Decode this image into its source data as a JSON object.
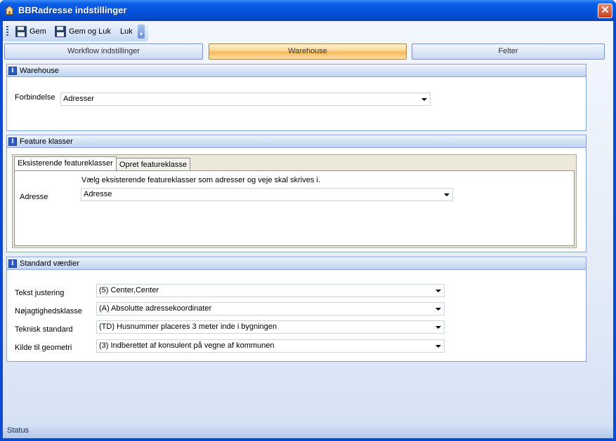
{
  "window": {
    "title": "BBRadresse indstillinger",
    "close_glyph": "✕"
  },
  "toolbar": {
    "save_label": "Gem",
    "save_close_label": "Gem og Luk",
    "close_label": "Luk",
    "more_glyph": "▾"
  },
  "tabs": [
    {
      "label": "Workflow indstillinger",
      "active": false
    },
    {
      "label": "Warehouse",
      "active": true
    },
    {
      "label": "Felter",
      "active": false
    }
  ],
  "warehouse": {
    "title": "Warehouse",
    "connection_label": "Forbindelse",
    "connection_value": "Adresser"
  },
  "feature_classes": {
    "title": "Feature klasser",
    "tabs": [
      {
        "label": "Eksisterende featureklasser",
        "active": true
      },
      {
        "label": "Opret featureklasse",
        "active": false
      }
    ],
    "description": "Vælg eksisterende featureklasser som adresser og veje skal skrives i.",
    "address_label": "Adresse",
    "address_value": "Adresse"
  },
  "standard_values": {
    "title": "Standard værdier",
    "rows": [
      {
        "label": "Tekst justering",
        "value": "(5) Center,Center"
      },
      {
        "label": "Nøjagtighedsklasse",
        "value": "(A) Absolutte adressekoordinater"
      },
      {
        "label": "Teknisk standard",
        "value": "(TD) Husnummer placeres 3 meter inde i bygningen"
      },
      {
        "label": "Kilde til geometri",
        "value": "(3) Indberettet af konsulent på vegne af kommunen"
      }
    ]
  },
  "status": {
    "text": "Status"
  },
  "icons": {
    "info_glyph": "i"
  },
  "colors": {
    "title_bar": "#0453d8",
    "active_tab": "#f7b857",
    "group_border": "#8aa6d6"
  }
}
